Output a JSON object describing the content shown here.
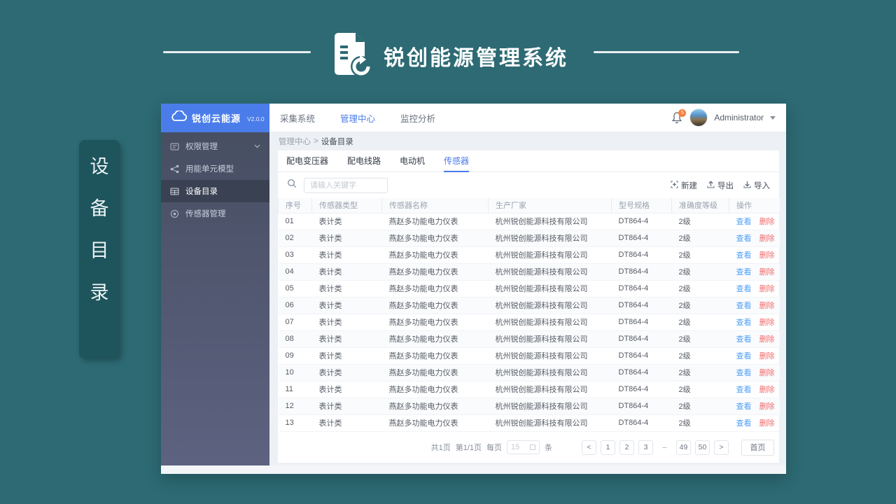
{
  "banner": {
    "title": "锐创能源管理系统"
  },
  "side_label": {
    "chars": [
      "设",
      "备",
      "目",
      "录"
    ]
  },
  "app": {
    "sidebar": {
      "logo_name": "锐创云能源",
      "logo_version": "V2.0.0",
      "items": [
        {
          "label": "权限管理",
          "active": false
        },
        {
          "label": "用能单元模型",
          "active": false
        },
        {
          "label": "设备目录",
          "active": true
        },
        {
          "label": "传感器管理",
          "active": false
        }
      ]
    },
    "topnav": {
      "items": [
        {
          "label": "采集系统",
          "active": false
        },
        {
          "label": "管理中心",
          "active": true
        },
        {
          "label": "监控分析",
          "active": false
        }
      ],
      "badge": "5",
      "user_name": "Administrator"
    },
    "breadcrumb": {
      "parent": "管理中心",
      "separator": ">",
      "current": "设备目录"
    },
    "tabs": [
      {
        "label": "配电变压器",
        "active": false
      },
      {
        "label": "配电线路",
        "active": false
      },
      {
        "label": "电动机",
        "active": false
      },
      {
        "label": "传感器",
        "active": true
      }
    ],
    "search": {
      "placeholder": "请输入关键字"
    },
    "toolbar": {
      "new_label": "新建",
      "export_label": "导出",
      "import_label": "导入"
    },
    "table": {
      "headers": [
        "序号",
        "传感器类型",
        "传感器名称",
        "生产厂家",
        "型号规格",
        "准确度等级",
        "操作"
      ],
      "actions": {
        "view": "查看",
        "delete": "删除"
      },
      "rows": [
        {
          "no": "01",
          "type": "表计类",
          "name": "燕赵多功能电力仪表",
          "manufacturer": "杭州锐创能源科技有限公司",
          "model": "DT864-4",
          "accuracy": "2级"
        },
        {
          "no": "02",
          "type": "表计类",
          "name": "燕赵多功能电力仪表",
          "manufacturer": "杭州锐创能源科技有限公司",
          "model": "DT864-4",
          "accuracy": "2级"
        },
        {
          "no": "03",
          "type": "表计类",
          "name": "燕赵多功能电力仪表",
          "manufacturer": "杭州锐创能源科技有限公司",
          "model": "DT864-4",
          "accuracy": "2级"
        },
        {
          "no": "04",
          "type": "表计类",
          "name": "燕赵多功能电力仪表",
          "manufacturer": "杭州锐创能源科技有限公司",
          "model": "DT864-4",
          "accuracy": "2级"
        },
        {
          "no": "05",
          "type": "表计类",
          "name": "燕赵多功能电力仪表",
          "manufacturer": "杭州锐创能源科技有限公司",
          "model": "DT864-4",
          "accuracy": "2级"
        },
        {
          "no": "06",
          "type": "表计类",
          "name": "燕赵多功能电力仪表",
          "manufacturer": "杭州锐创能源科技有限公司",
          "model": "DT864-4",
          "accuracy": "2级"
        },
        {
          "no": "07",
          "type": "表计类",
          "name": "燕赵多功能电力仪表",
          "manufacturer": "杭州锐创能源科技有限公司",
          "model": "DT864-4",
          "accuracy": "2级"
        },
        {
          "no": "08",
          "type": "表计类",
          "name": "燕赵多功能电力仪表",
          "manufacturer": "杭州锐创能源科技有限公司",
          "model": "DT864-4",
          "accuracy": "2级"
        },
        {
          "no": "09",
          "type": "表计类",
          "name": "燕赵多功能电力仪表",
          "manufacturer": "杭州锐创能源科技有限公司",
          "model": "DT864-4",
          "accuracy": "2级"
        },
        {
          "no": "10",
          "type": "表计类",
          "name": "燕赵多功能电力仪表",
          "manufacturer": "杭州锐创能源科技有限公司",
          "model": "DT864-4",
          "accuracy": "2级"
        },
        {
          "no": "11",
          "type": "表计类",
          "name": "燕赵多功能电力仪表",
          "manufacturer": "杭州锐创能源科技有限公司",
          "model": "DT864-4",
          "accuracy": "2级"
        },
        {
          "no": "12",
          "type": "表计类",
          "name": "燕赵多功能电力仪表",
          "manufacturer": "杭州锐创能源科技有限公司",
          "model": "DT864-4",
          "accuracy": "2级"
        },
        {
          "no": "13",
          "type": "表计类",
          "name": "燕赵多功能电力仪表",
          "manufacturer": "杭州锐创能源科技有限公司",
          "model": "DT864-4",
          "accuracy": "2级"
        }
      ]
    },
    "pagination": {
      "total_text": "共1页",
      "page_text": "第1/1页",
      "per_page_label": "每页",
      "per_page_value": "15",
      "unit_label": "条",
      "prev": "<",
      "next": ">",
      "pages": [
        {
          "label": "1"
        },
        {
          "label": "2"
        },
        {
          "label": "3"
        },
        {
          "label": "–",
          "ellipsis": true
        },
        {
          "label": "49"
        },
        {
          "label": "50"
        }
      ],
      "first_label": "首页"
    }
  },
  "colors": {
    "background_teal": "#2d6a73",
    "label_box_teal": "#1e545c",
    "logo_blue": "#4a7de9",
    "accent_blue": "#4a7ce8",
    "view_link": "#4da0f8",
    "delete_link": "#f26a6a",
    "badge_orange": "#f6803a",
    "sidebar_slate": "#4d5468"
  }
}
